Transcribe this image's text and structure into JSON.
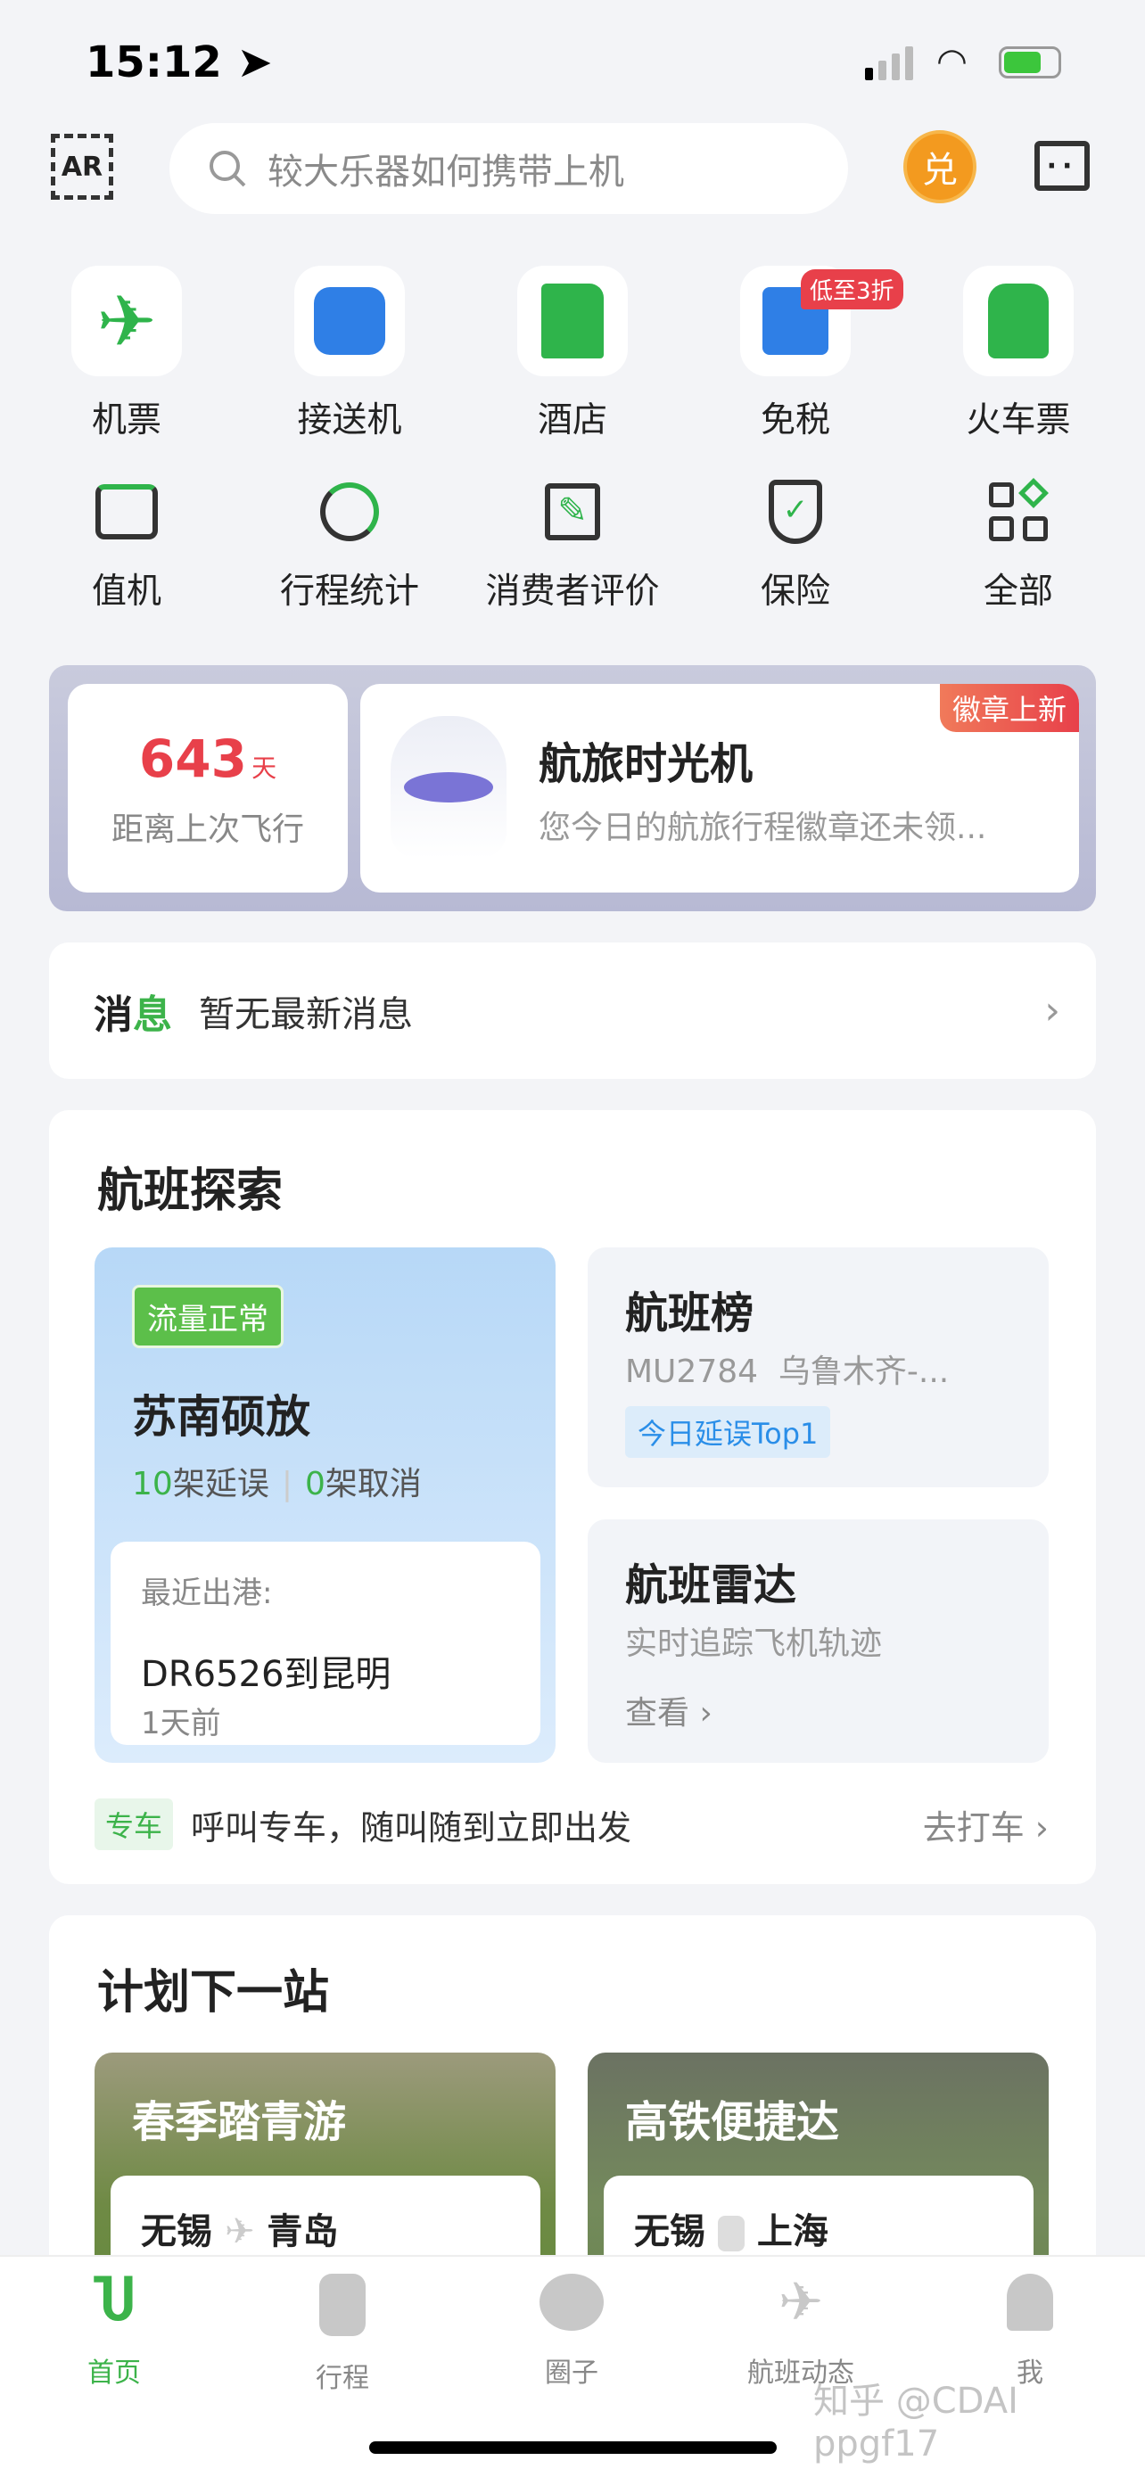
{
  "status": {
    "time": "15:12"
  },
  "header": {
    "ar_label": "AR",
    "search_placeholder": "较大乐器如何携带上机",
    "coin_label": "兑"
  },
  "grid": [
    {
      "label": "机票",
      "icon": "plane-icon"
    },
    {
      "label": "接送机",
      "icon": "car-icon"
    },
    {
      "label": "酒店",
      "icon": "hotel-icon"
    },
    {
      "label": "免税",
      "icon": "shop-icon",
      "badge": "低至3折"
    },
    {
      "label": "火车票",
      "icon": "train-icon"
    },
    {
      "label": "值机",
      "icon": "checkin-icon"
    },
    {
      "label": "行程统计",
      "icon": "pie-chart-icon"
    },
    {
      "label": "消费者评价",
      "icon": "edit-icon"
    },
    {
      "label": "保险",
      "icon": "shield-icon"
    },
    {
      "label": "全部",
      "icon": "apps-icon"
    }
  ],
  "banner": {
    "days": "643",
    "days_unit": "天",
    "days_caption": "距离上次飞行",
    "title": "航旅时光机",
    "subtitle": "您今日的航旅行程徽章还未领...",
    "tag": "徽章上新"
  },
  "message": {
    "label_a": "消",
    "label_b": "息",
    "text": "暂无最新消息"
  },
  "explore": {
    "title": "航班探索",
    "airport": {
      "status": "流量正常",
      "name": "苏南硕放",
      "delayed_count": "10",
      "delayed_label": "架延误",
      "cancelled_count": "0",
      "cancelled_label": "架取消",
      "recent_label": "最近出港:",
      "recent_flight": "DR6526到昆明",
      "recent_time": "1天前"
    },
    "ranking": {
      "title": "航班榜",
      "flight": "MU2784  乌鲁木齐-...",
      "tag": "今日延误Top1"
    },
    "radar": {
      "title": "航班雷达",
      "subtitle": "实时追踪飞机轨迹",
      "link": "查看"
    },
    "car": {
      "tag": "专车",
      "text": "呼叫专车，随叫随到立即出发",
      "link": "去打车"
    }
  },
  "plan": {
    "title": "计划下一站",
    "cards": [
      {
        "title": "春季踏青游",
        "from": "无锡",
        "to": "青岛",
        "mode": "plane-icon"
      },
      {
        "title": "高铁便捷达",
        "from": "无锡",
        "to": "上海",
        "mode": "train-icon"
      }
    ]
  },
  "tabs": [
    {
      "label": "首页",
      "active": true
    },
    {
      "label": "行程"
    },
    {
      "label": "圈子"
    },
    {
      "label": "航班动态"
    },
    {
      "label": "我"
    }
  ],
  "watermark": "知乎 @CDAI ppgf17",
  "colors": {
    "accent": "#3cb34a",
    "red": "#e8404a",
    "blue": "#2a8ee8"
  }
}
